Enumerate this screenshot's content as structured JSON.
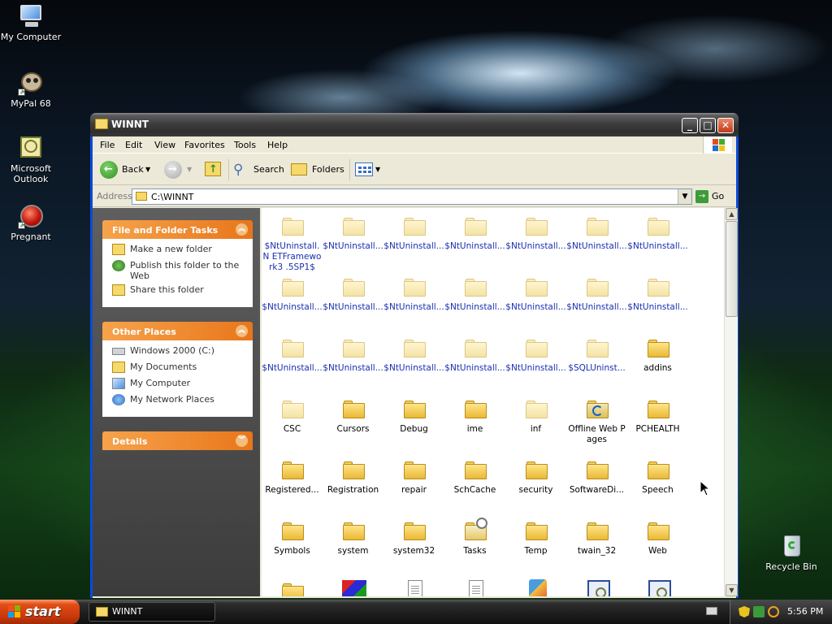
{
  "desktop": {
    "icons": [
      {
        "label": "My Computer"
      },
      {
        "label": "MyPal 68"
      },
      {
        "label": "Microsoft Outlook"
      },
      {
        "label": "Pregnant"
      },
      {
        "label": "Recycle Bin"
      }
    ]
  },
  "window": {
    "title": "WINNT",
    "menu": [
      "File",
      "Edit",
      "View",
      "Favorites",
      "Tools",
      "Help"
    ],
    "toolbar": {
      "back": "Back",
      "search": "Search",
      "folders": "Folders"
    },
    "address": {
      "label": "Address",
      "value": "C:\\WINNT",
      "go": "Go"
    }
  },
  "taskpane": {
    "file_folder_tasks": {
      "title": "File and Folder Tasks",
      "items": [
        "Make a new folder",
        "Publish this folder to the Web",
        "Share this folder"
      ]
    },
    "other_places": {
      "title": "Other Places",
      "items": [
        "Windows 2000 (C:)",
        "My Documents",
        "My Computer",
        "My Network Places"
      ]
    },
    "details": {
      "title": "Details"
    }
  },
  "files": [
    {
      "name": "$NtUninstall.NETFramework3.5SP1$",
      "display": "$NtUninstall.N ETFramework3 .5SP1$",
      "hidden": true
    },
    {
      "name": "$NtUninstall...",
      "hidden": true
    },
    {
      "name": "$NtUninstall...",
      "hidden": true
    },
    {
      "name": "$NtUninstall...",
      "hidden": true
    },
    {
      "name": "$NtUninstall...",
      "hidden": true
    },
    {
      "name": "$NtUninstall...",
      "hidden": true
    },
    {
      "name": "$NtUninstall...",
      "hidden": true
    },
    {
      "name": "$NtUninstall...",
      "hidden": true
    },
    {
      "name": "$NtUninstall...",
      "hidden": true
    },
    {
      "name": "$NtUninstall...",
      "hidden": true
    },
    {
      "name": "$NtUninstall...",
      "hidden": true
    },
    {
      "name": "$NtUninstall...",
      "hidden": true
    },
    {
      "name": "$NtUninstall...",
      "hidden": true
    },
    {
      "name": "$NtUninstall...",
      "hidden": true
    },
    {
      "name": "$NtUninstall...",
      "hidden": true
    },
    {
      "name": "$NtUninstall...",
      "hidden": true
    },
    {
      "name": "$NtUninstall...",
      "hidden": true
    },
    {
      "name": "$NtUninstall...",
      "hidden": true
    },
    {
      "name": "$NtUninstall...",
      "hidden": true
    },
    {
      "name": "$SQLUninst...",
      "hidden": true
    },
    {
      "name": "addins",
      "hidden": false
    },
    {
      "name": "CSC",
      "hidden": false,
      "ghost": true
    },
    {
      "name": "Cursors",
      "hidden": false
    },
    {
      "name": "Debug",
      "hidden": false
    },
    {
      "name": "ime",
      "hidden": false
    },
    {
      "name": "inf",
      "hidden": false,
      "ghost": true
    },
    {
      "name": "Offline Web Pages",
      "hidden": false,
      "icon": "offline-web-pages-icon"
    },
    {
      "name": "PCHEALTH",
      "hidden": false
    },
    {
      "name": "Registered...",
      "hidden": false
    },
    {
      "name": "Registration",
      "hidden": false
    },
    {
      "name": "repair",
      "hidden": false
    },
    {
      "name": "SchCache",
      "hidden": false
    },
    {
      "name": "security",
      "hidden": false
    },
    {
      "name": "SoftwareDi...",
      "hidden": false
    },
    {
      "name": "Speech",
      "hidden": false
    },
    {
      "name": "Symbols",
      "hidden": false
    },
    {
      "name": "system",
      "hidden": false
    },
    {
      "name": "system32",
      "hidden": false
    },
    {
      "name": "Tasks",
      "hidden": false,
      "icon": "tasks-folder-icon"
    },
    {
      "name": "Temp",
      "hidden": false
    },
    {
      "name": "twain_32",
      "hidden": false
    },
    {
      "name": "Web",
      "hidden": false
    },
    {
      "name": "",
      "icon": "folder-icon"
    },
    {
      "name": "",
      "icon": "msi-installer-icon"
    },
    {
      "name": "",
      "icon": "text-document-icon"
    },
    {
      "name": "",
      "icon": "text-document-icon"
    },
    {
      "name": "",
      "icon": "paint-brush-icon"
    },
    {
      "name": "",
      "icon": "setup-program-icon"
    },
    {
      "name": "",
      "icon": "setup-program-icon"
    }
  ],
  "taskbar": {
    "start": "start",
    "window_button": "WINNT",
    "clock": "5:56 PM"
  },
  "colors": {
    "titlebar": "#3e3e3e",
    "panel_header": "#f0893a",
    "taskbar": "#1c1c1c",
    "start_button": "#d2400e",
    "hidden_file_text": "#1a2fb0"
  }
}
